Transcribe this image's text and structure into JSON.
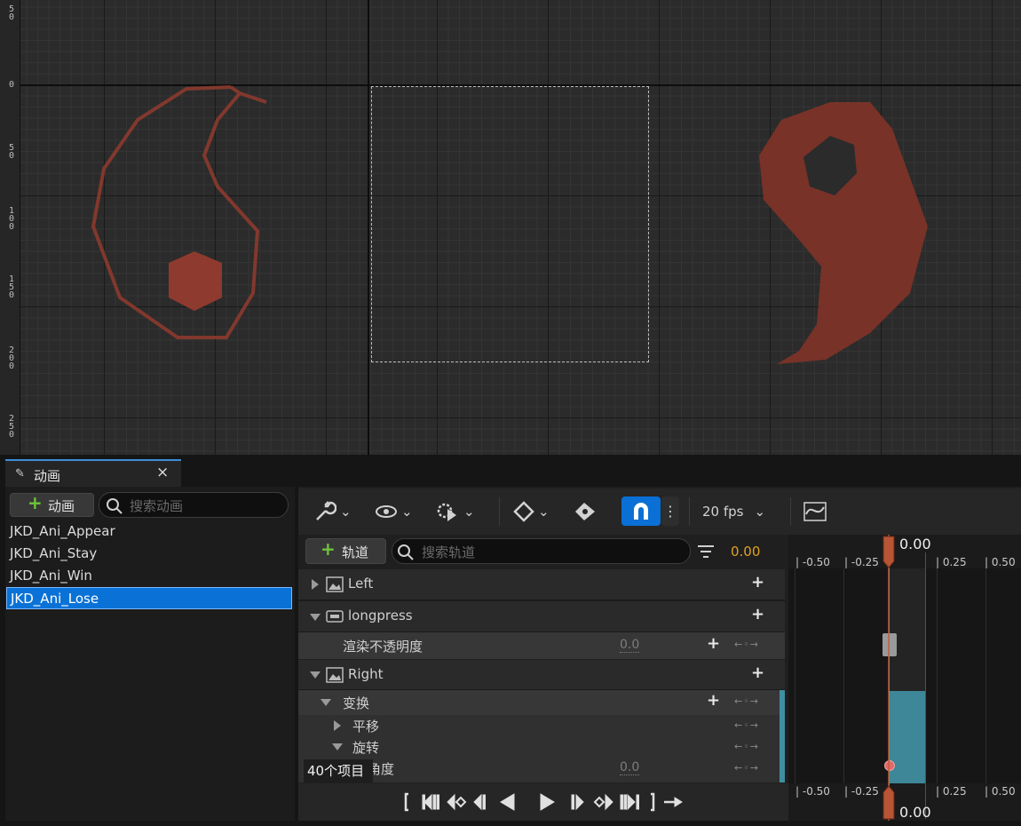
{
  "viewport": {
    "ruler_labels": [
      "5\n0",
      "0",
      "5\n0",
      "1\n0\n0",
      "1\n5\n0",
      "2\n0\n0",
      "2\n5\n0"
    ],
    "accent_color": "#b0402f"
  },
  "tab": {
    "label": "动画",
    "close": "×",
    "icon": "pen-icon"
  },
  "animations": {
    "add_button": "动画",
    "search_placeholder": "搜索动画",
    "items": [
      "JKD_Ani_Appear",
      "JKD_Ani_Stay",
      "JKD_Ani_Win",
      "JKD_Ani_Lose"
    ],
    "selected_index": 3
  },
  "toolbar": {
    "fps_label": "20 fps",
    "icons": [
      "wrench-icon",
      "eye-icon",
      "gear-play-icon",
      "key-diamond-icon",
      "key-tag-icon",
      "snap-magnet-icon",
      "more-icon",
      "curve-editor-icon"
    ]
  },
  "tracks": {
    "add_button": "轨道",
    "search_placeholder": "搜索轨道",
    "current_time": "0.00",
    "rows": [
      {
        "label": "Left"
      },
      {
        "label": "longpress"
      },
      {
        "label": "渲染不透明度",
        "value": "0.0"
      },
      {
        "label": "Right"
      },
      {
        "label": "变换"
      },
      {
        "label": "平移"
      },
      {
        "label": "旋转"
      },
      {
        "label": "角度",
        "value": "0.0"
      }
    ]
  },
  "timeline": {
    "ticks": [
      "-0.50",
      "-0.25",
      "0.25",
      "0.50"
    ],
    "playhead_top": "0.00",
    "playhead_bottom": "0.00"
  },
  "tooltip": "40个项目"
}
